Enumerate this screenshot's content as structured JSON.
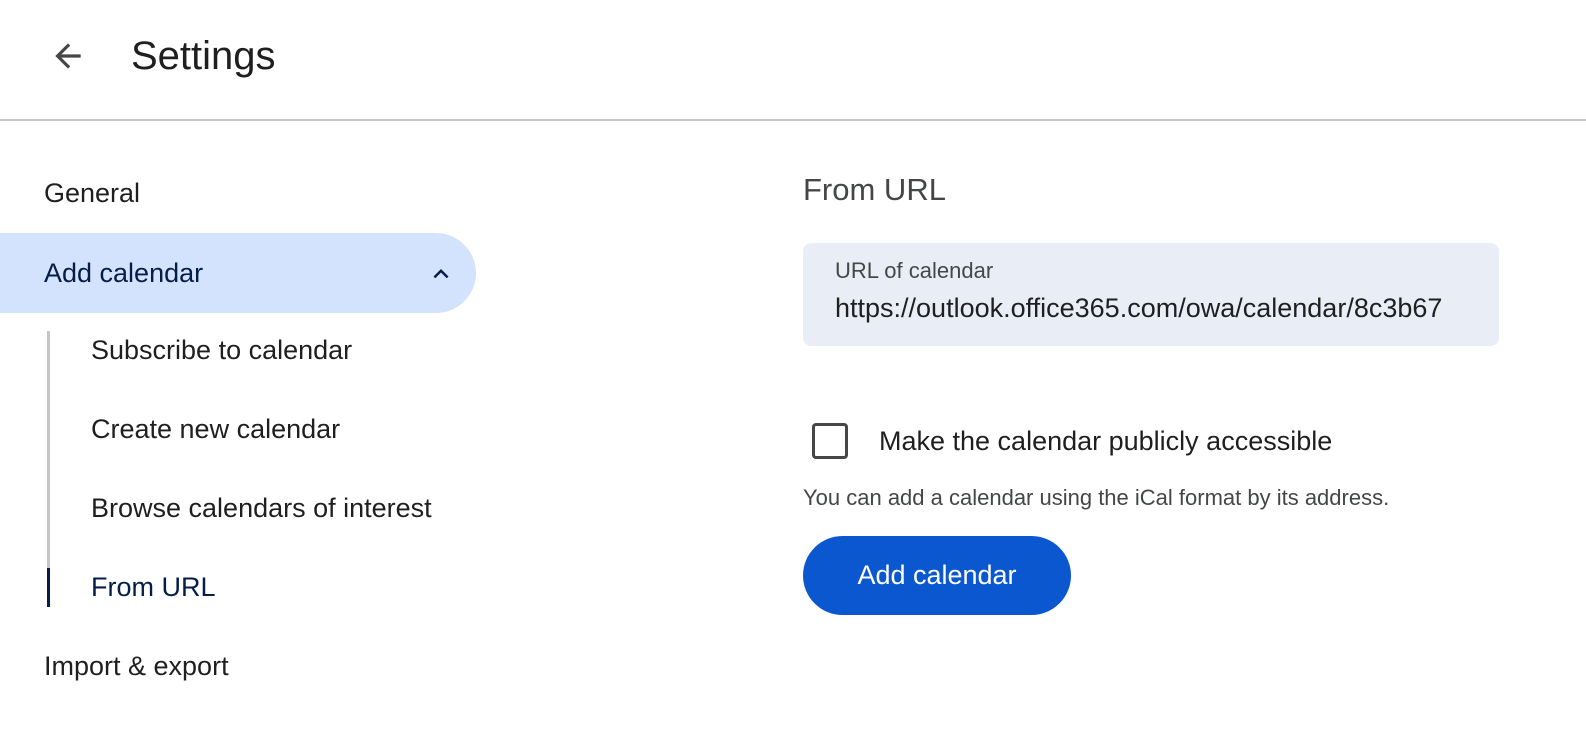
{
  "header": {
    "title": "Settings",
    "back_icon": "arrow-back-icon"
  },
  "sidebar": {
    "general_label": "General",
    "add_calendar_label": "Add calendar",
    "add_calendar_chevron": "chevron-up-icon",
    "sub_items": [
      {
        "label": "Subscribe to calendar"
      },
      {
        "label": "Create new calendar"
      },
      {
        "label": "Browse calendars of interest"
      },
      {
        "label": "From URL"
      }
    ],
    "import_export_label": "Import & export"
  },
  "main": {
    "section_title": "From URL",
    "url_field": {
      "label": "URL of calendar",
      "value": "https://outlook.office365.com/owa/calendar/8c3b67"
    },
    "public_checkbox": {
      "label": "Make the calendar publicly accessible",
      "checked": false
    },
    "helper_text": "You can add a calendar using the iCal format by its address.",
    "add_button_label": "Add calendar"
  },
  "colors": {
    "accent": "#0b57d0",
    "selected_nav_bg": "#d3e3fd",
    "field_bg": "#e9eef6",
    "selected_text": "#041e49"
  }
}
